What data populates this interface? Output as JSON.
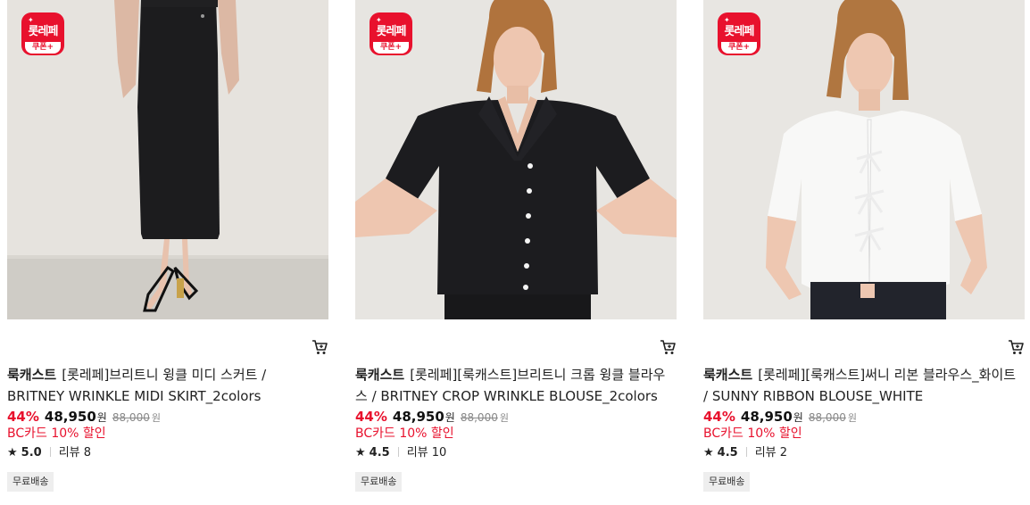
{
  "products": [
    {
      "badge_main": "롯레페",
      "badge_sub": "쿠폰+",
      "brand": "룩캐스트",
      "name": "[롯레페]브리트니 윙클 미디 스커트 / BRITNEY WRINKLE MIDI SKIRT_2colors",
      "discount_rate": "44%",
      "price": "48,950",
      "currency": "원",
      "original_price": "88,000",
      "card_discount": "BC카드 10% 할인",
      "rating": "5.0",
      "review_label": "리뷰 8",
      "tag": "무료배송"
    },
    {
      "badge_main": "롯레페",
      "badge_sub": "쿠폰+",
      "brand": "룩캐스트",
      "name": "[롯레페][룩캐스트]브리트니 크롭 윙클 블라우스 / BRITNEY CROP WRINKLE BLOUSE_2colors",
      "discount_rate": "44%",
      "price": "48,950",
      "currency": "원",
      "original_price": "88,000",
      "card_discount": "BC카드 10% 할인",
      "rating": "4.5",
      "review_label": "리뷰 10",
      "tag": "무료배송"
    },
    {
      "badge_main": "롯레페",
      "badge_sub": "쿠폰+",
      "brand": "룩캐스트",
      "name": "[롯레페][룩캐스트]써니 리본 블라우스_화이트 / SUNNY RIBBON BLOUSE_WHITE",
      "discount_rate": "44%",
      "price": "48,950",
      "currency": "원",
      "original_price": "88,000",
      "card_discount": "BC카드 10% 할인",
      "rating": "4.5",
      "review_label": "리뷰 2",
      "tag": "무료배송"
    }
  ],
  "icons": {
    "cart": "cart-icon",
    "star": "star-icon",
    "badge": "lotte-coupon-badge"
  },
  "colors": {
    "accent": "#e8112d",
    "strike": "#888888",
    "tag_bg": "#eeeeee"
  }
}
